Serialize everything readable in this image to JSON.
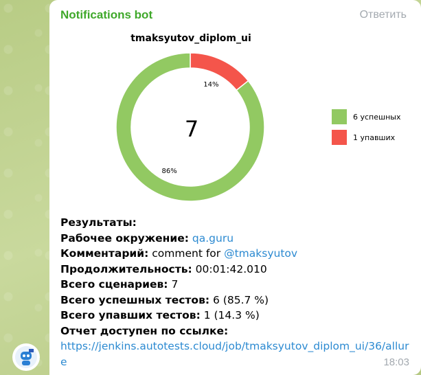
{
  "message": {
    "sender": "Notifications bot",
    "reply_label": "Ответить",
    "time": "18:03"
  },
  "chart_data": {
    "type": "pie",
    "title": "tmaksyutov_diplom_ui",
    "center_label": "7",
    "slices": [
      {
        "label": "6 успешных",
        "value": 6,
        "percent_label": "86%",
        "color": "#92c962"
      },
      {
        "label": "1 упавших",
        "value": 1,
        "percent_label": "14%",
        "color": "#f4554b"
      }
    ],
    "legend_position": "right"
  },
  "info": {
    "heading": "Результаты:",
    "env_label": "Рабочее окружение:",
    "env_value": "qa.guru",
    "comment_label": "Комментарий:",
    "comment_text": "comment for",
    "comment_mention": "@tmaksyutov",
    "duration_label": "Продолжительность:",
    "duration_value": "00:01:42.010",
    "scenarios_label": "Всего сценариев:",
    "scenarios_value": "7",
    "passed_label": "Всего успешных тестов:",
    "passed_value": "6 (85.7 %)",
    "failed_label": "Всего упавших тестов:",
    "failed_value": "1 (14.3 %)",
    "report_label": "Отчет доступен по ссылке:",
    "report_url": "https://jenkins.autotests.cloud/job/tmaksyutov_diplom_ui/36/allure"
  }
}
